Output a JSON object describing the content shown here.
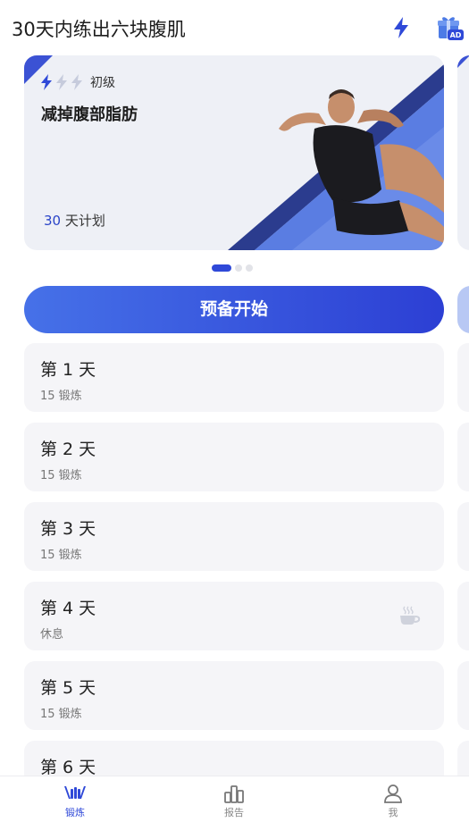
{
  "header": {
    "title": "30天内练出六块腹肌",
    "flash_icon": "lightning-icon",
    "ad_badge": "AD"
  },
  "plan_card": {
    "level_label": "初级",
    "level_value": 1,
    "level_max": 3,
    "title": "减掉腹部脂肪",
    "days_number": "30",
    "days_suffix": " 天计划"
  },
  "carousel": {
    "page_count": 3,
    "current_page": 1
  },
  "start_button": {
    "label": "预备开始"
  },
  "days": [
    {
      "title": "第 1 天",
      "subtitle": "15 锻炼",
      "rest": false
    },
    {
      "title": "第 2 天",
      "subtitle": "15 锻炼",
      "rest": false
    },
    {
      "title": "第 3 天",
      "subtitle": "15 锻炼",
      "rest": false
    },
    {
      "title": "第 4 天",
      "subtitle": "休息",
      "rest": true
    },
    {
      "title": "第 5 天",
      "subtitle": "15 锻炼",
      "rest": false
    },
    {
      "title": "第 6 天",
      "subtitle": "",
      "rest": false
    }
  ],
  "tabs": [
    {
      "label": "锻炼",
      "icon": "workout-icon",
      "active": true
    },
    {
      "label": "报告",
      "icon": "report-icon",
      "active": false
    },
    {
      "label": "我",
      "icon": "profile-icon",
      "active": false
    }
  ],
  "colors": {
    "accent": "#2f49d8",
    "card_bg": "#eef0f6",
    "row_bg": "#f5f5f8"
  }
}
